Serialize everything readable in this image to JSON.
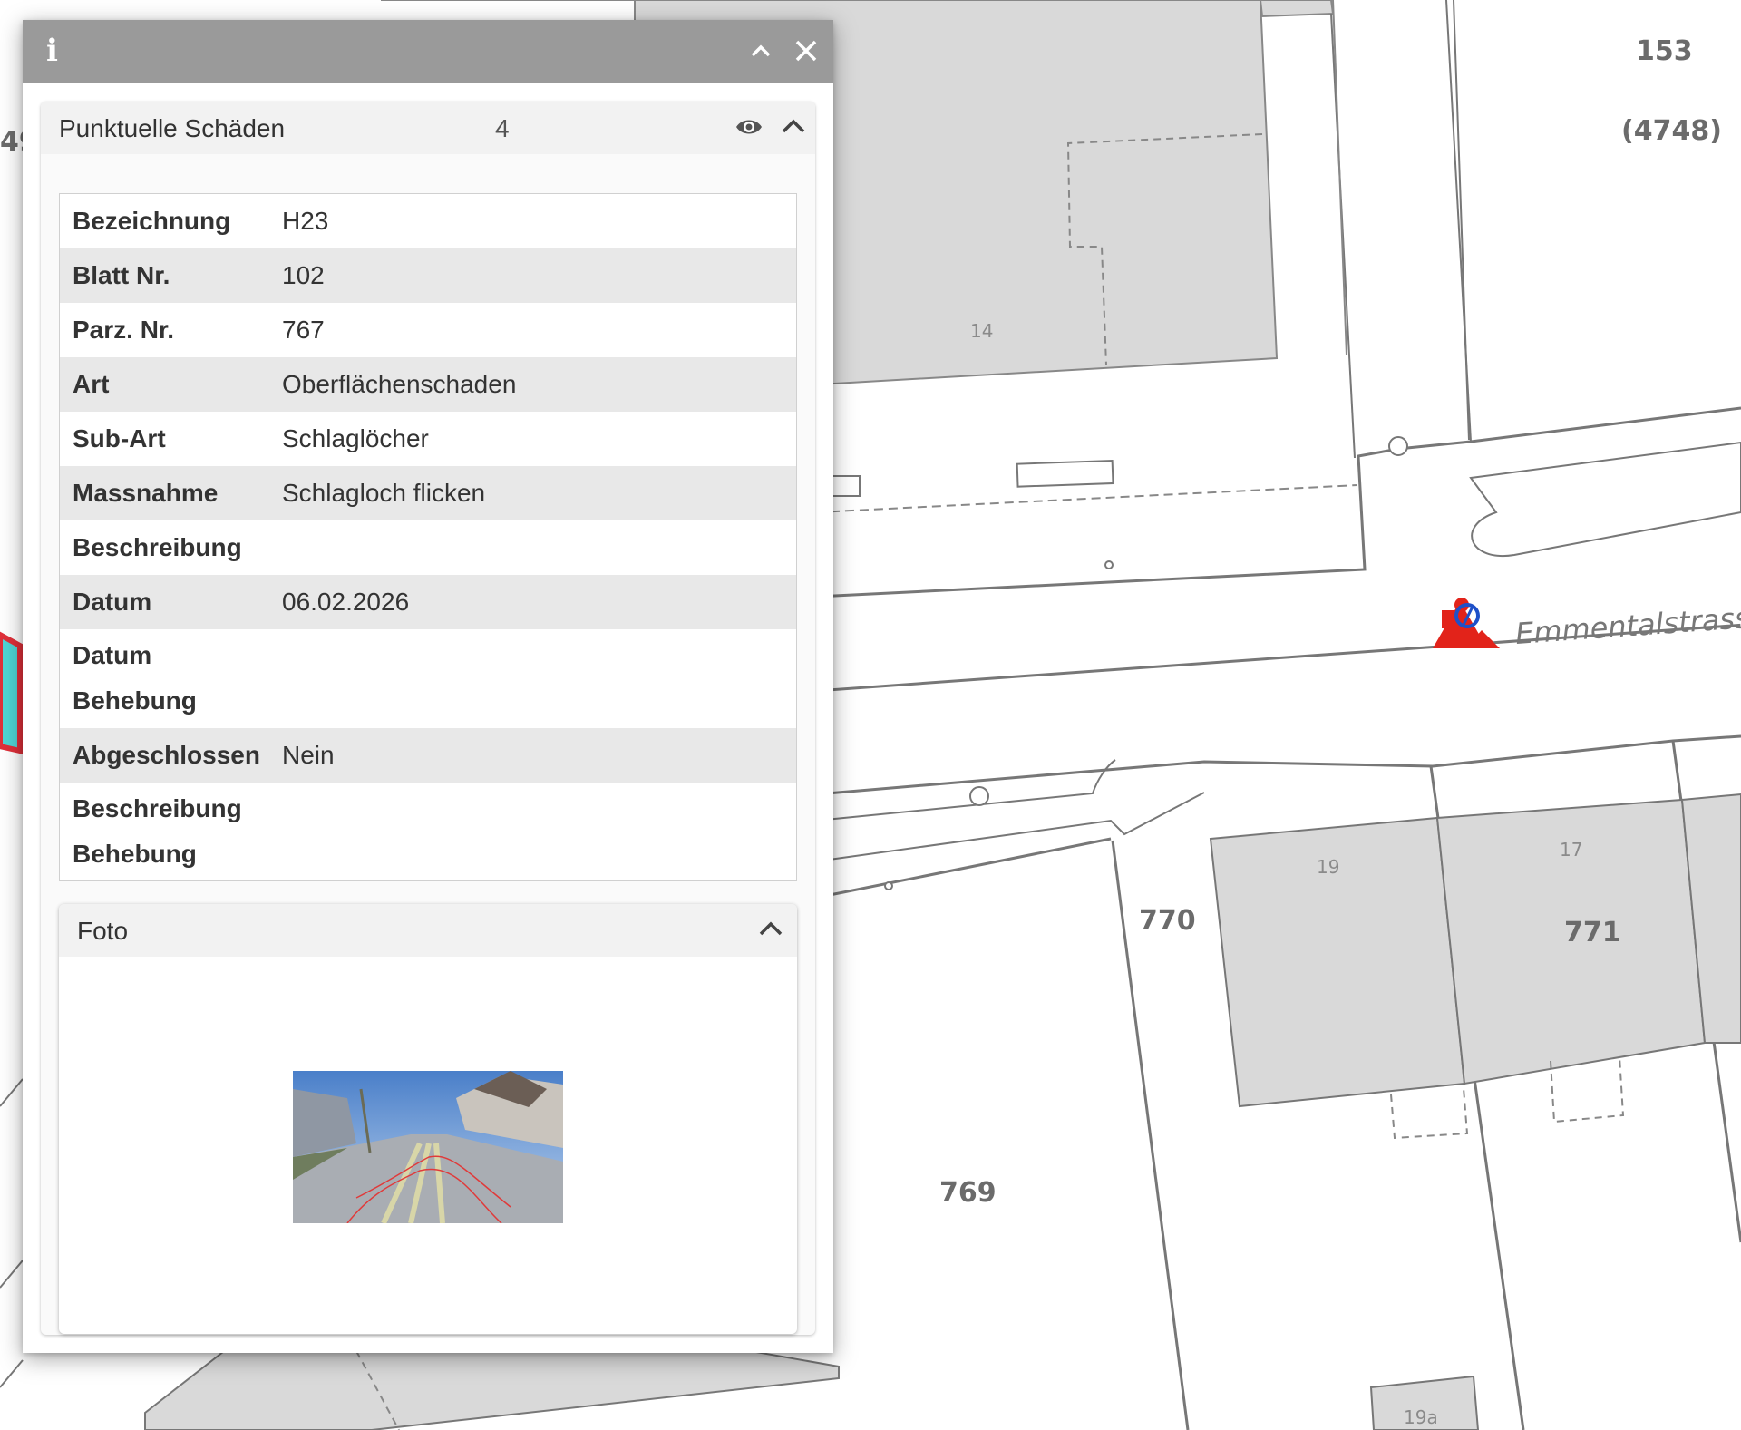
{
  "map": {
    "parcel_labels": [
      "153",
      "(4748)",
      "770",
      "771",
      "769",
      "49"
    ],
    "house_numbers": [
      "14",
      "19",
      "17",
      "19a"
    ],
    "street_name": "Emmentalstrasse"
  },
  "panel": {
    "header": {
      "info_icon": "info-icon",
      "collapse_icon": "chevron-up-icon",
      "close_icon": "close-icon"
    },
    "layer": {
      "title": "Punktuelle Schäden",
      "count": "4"
    },
    "attributes": [
      {
        "key": "Bezeichnung",
        "value": "H23"
      },
      {
        "key": "Blatt Nr.",
        "value": "102"
      },
      {
        "key": "Parz. Nr.",
        "value": "767"
      },
      {
        "key": "Art",
        "value": "Oberflächenschaden"
      },
      {
        "key": "Sub-Art",
        "value": "Schlaglöcher"
      },
      {
        "key": "Massnahme",
        "value": "Schlagloch flicken"
      },
      {
        "key": "Beschreibung",
        "value": ""
      },
      {
        "key": "Datum",
        "value": "06.02.2026"
      },
      {
        "key": "Datum Behebung",
        "value": ""
      },
      {
        "key": "Abgeschlossen",
        "value": "Nein"
      },
      {
        "key": "Beschreibung Behebung",
        "value": ""
      }
    ],
    "foto": {
      "title": "Foto"
    }
  },
  "colors": {
    "header": "#9a9a9a",
    "highlight_fill": "#4fd6d6",
    "highlight_stroke": "#e0303a",
    "marker": "#e2231a"
  }
}
